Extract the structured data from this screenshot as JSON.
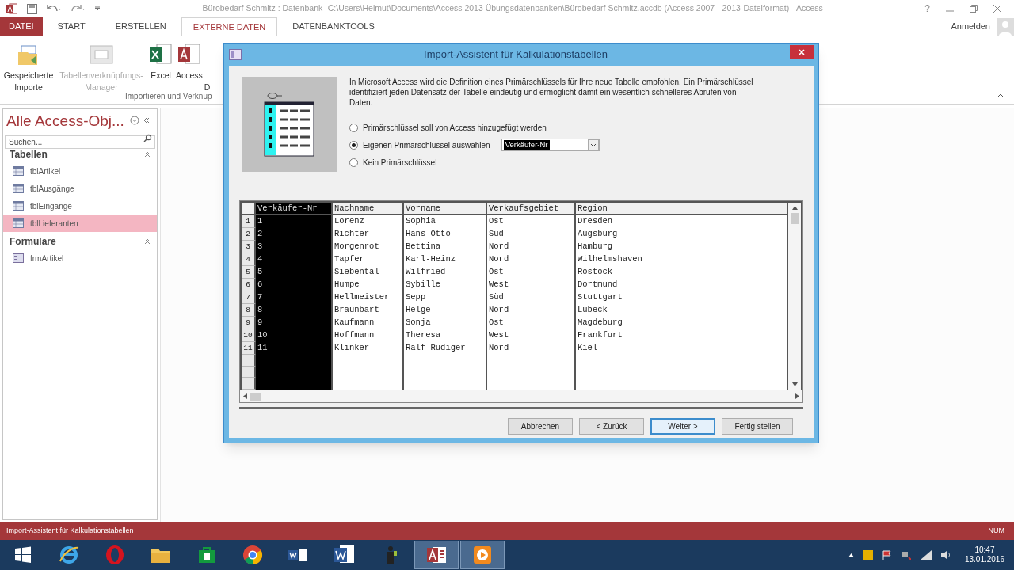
{
  "window": {
    "title": "Bürobedarf Schmitz : Datenbank- C:\\Users\\Helmut\\Documents\\Access 2013 Übungsdatenbanken\\Bürobedarf Schmitz.accdb (Access 2007 - 2013-Dateiformat) - Access",
    "help": "?"
  },
  "ribbon_tabs": [
    {
      "label": "DATEI",
      "kind": "file",
      "selected": false
    },
    {
      "label": "START",
      "kind": "tab",
      "selected": false
    },
    {
      "label": "ERSTELLEN",
      "kind": "tab",
      "selected": false
    },
    {
      "label": "EXTERNE DATEN",
      "kind": "tab",
      "selected": true
    },
    {
      "label": "DATENBANKTOOLS",
      "kind": "tab",
      "selected": false
    }
  ],
  "account": "Anmelden",
  "ribbon": {
    "buttons": [
      {
        "label": "Gespeicherte Importe",
        "kind": "saved",
        "disabled": false
      },
      {
        "label": "Tabellenverknüpfungs-Manager",
        "kind": "linked",
        "disabled": true
      },
      {
        "label": "Excel",
        "kind": "excel",
        "disabled": false
      },
      {
        "label": "Access",
        "kind": "access",
        "disabled": false
      },
      {
        "label": "D",
        "kind": "cut",
        "disabled": false
      }
    ],
    "group_label": "Importieren und Verknüp"
  },
  "nav_pane": {
    "title": "Alle Access-Obj...",
    "search": {
      "placeholder": "Suchen..."
    },
    "groups": [
      {
        "label": "Tabellen",
        "items": [
          {
            "label": "tblArtikel",
            "kind": "table",
            "selected": false
          },
          {
            "label": "tblAusgänge",
            "kind": "table",
            "selected": false
          },
          {
            "label": "tblEingänge",
            "kind": "table",
            "selected": false
          },
          {
            "label": "tblLieferanten",
            "kind": "table",
            "selected": true
          }
        ]
      },
      {
        "label": "Formulare",
        "items": [
          {
            "label": "frmArtikel",
            "kind": "form",
            "selected": false
          }
        ]
      }
    ]
  },
  "dialog": {
    "title": "Import-Assistent für Kalkulationstabellen",
    "description": "In Microsoft Access wird die Definition eines Primärschlüssels für Ihre neue Tabelle empfohlen. Ein Primärschlüssel identifiziert jeden Datensatz der Tabelle eindeutig und ermöglicht damit ein wesentlich schnelleres Abrufen von Daten.",
    "options": [
      {
        "label": "Primärschlüssel soll von Access hinzugefügt werden",
        "selected": false
      },
      {
        "label": "Eigenen Primärschlüssel auswählen",
        "selected": true
      },
      {
        "label": "Kein Primärschlüssel",
        "selected": false
      }
    ],
    "key_field": {
      "value": "Verkäufer-Nr"
    },
    "table": {
      "columns": [
        {
          "label": "Verkäufer-Nr",
          "selected": true
        },
        {
          "label": "Nachname",
          "selected": false
        },
        {
          "label": "Vorname",
          "selected": false
        },
        {
          "label": "Verkaufsgebiet",
          "selected": false
        },
        {
          "label": "Region",
          "selected": false
        }
      ],
      "rows": [
        {
          "number": "1",
          "cells": [
            "1",
            "Lorenz",
            "Sophia",
            "Ost",
            "Dresden"
          ]
        },
        {
          "number": "2",
          "cells": [
            "2",
            "Richter",
            "Hans-Otto",
            "Süd",
            "Augsburg"
          ]
        },
        {
          "number": "3",
          "cells": [
            "3",
            "Morgenrot",
            "Bettina",
            "Nord",
            "Hamburg"
          ]
        },
        {
          "number": "4",
          "cells": [
            "4",
            "Tapfer",
            "Karl-Heinz",
            "Nord",
            "Wilhelmshaven"
          ]
        },
        {
          "number": "5",
          "cells": [
            "5",
            "Siebental",
            "Wilfried",
            "Ost",
            "Rostock"
          ]
        },
        {
          "number": "6",
          "cells": [
            "6",
            "Humpe",
            "Sybille",
            "West",
            "Dortmund"
          ]
        },
        {
          "number": "7",
          "cells": [
            "7",
            "Hellmeister",
            "Sepp",
            "Süd",
            "Stuttgart"
          ]
        },
        {
          "number": "8",
          "cells": [
            "8",
            "Braunbart",
            "Helge",
            "Nord",
            "Lübeck"
          ]
        },
        {
          "number": "9",
          "cells": [
            "9",
            "Kaufmann",
            "Sonja",
            "Ost",
            "Magdeburg"
          ]
        },
        {
          "number": "10",
          "cells": [
            "10",
            "Hoffmann",
            "Theresa",
            "West",
            "Frankfurt"
          ]
        },
        {
          "number": "11",
          "cells": [
            "11",
            "Klinker",
            "Ralf-Rüdiger",
            "Nord",
            "Kiel"
          ]
        }
      ]
    },
    "buttons": [
      {
        "label": "Abbrechen",
        "default": false
      },
      {
        "label": "< Zurück",
        "default": false
      },
      {
        "label": "Weiter >",
        "default": true
      },
      {
        "label": "Fertig stellen",
        "default": false
      }
    ]
  },
  "status_bar": {
    "text": "Import-Assistent für Kalkulationstabellen",
    "indicator": "NUM"
  },
  "taskbar": {
    "apps": [
      {
        "kind": "start",
        "active": false
      },
      {
        "kind": "ie",
        "active": false
      },
      {
        "kind": "opera",
        "active": false
      },
      {
        "kind": "explorer",
        "active": false
      },
      {
        "kind": "store",
        "active": false
      },
      {
        "kind": "chrome",
        "active": false
      },
      {
        "kind": "word-small",
        "active": false
      },
      {
        "kind": "word",
        "active": false
      },
      {
        "kind": "figure",
        "active": false
      },
      {
        "kind": "access",
        "active": true
      },
      {
        "kind": "player",
        "active": true
      }
    ],
    "time": "10:47",
    "date": "13.01.2016"
  }
}
